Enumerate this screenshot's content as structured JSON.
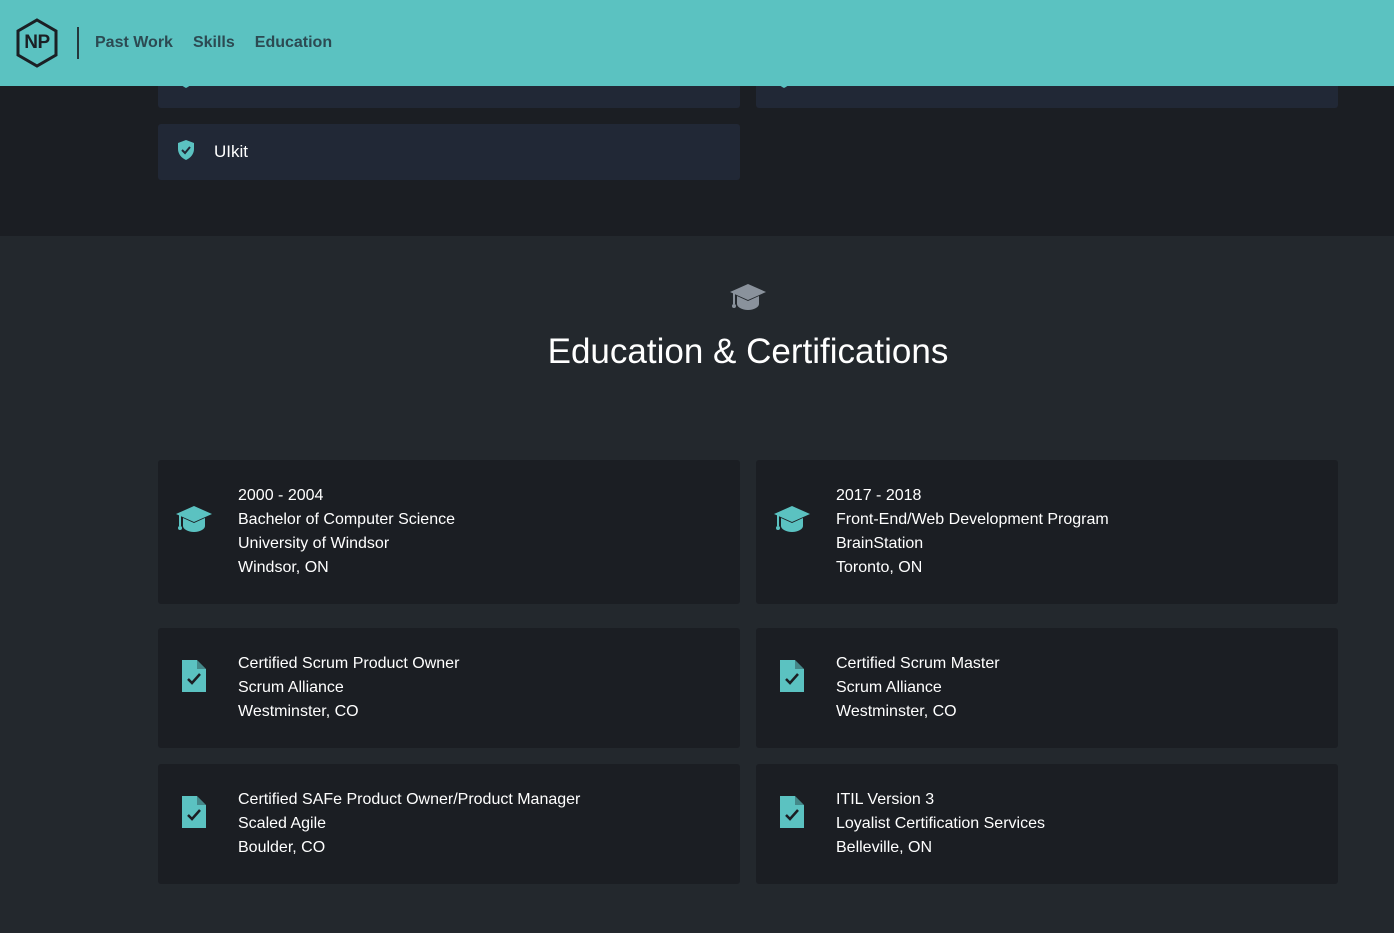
{
  "nav": {
    "logo_text": "NP",
    "links": [
      "Past Work",
      "Skills",
      "Education"
    ]
  },
  "skills": {
    "visible_card_label": "UIkit"
  },
  "education": {
    "title": "Education & Certifications",
    "degrees": [
      {
        "years": "2000 - 2004",
        "program": "Bachelor of Computer Science",
        "school": "University of Windsor",
        "location": "Windsor, ON"
      },
      {
        "years": "2017 - 2018",
        "program": "Front-End/Web Development Program",
        "school": "BrainStation",
        "location": "Toronto, ON"
      }
    ],
    "certifications": [
      {
        "name": "Certified Scrum Product Owner",
        "issuer": "Scrum Alliance",
        "location": "Westminster, CO"
      },
      {
        "name": "Certified Scrum Master",
        "issuer": "Scrum Alliance",
        "location": "Westminster, CO"
      },
      {
        "name": "Certified SAFe Product Owner/Product Manager",
        "issuer": "Scaled Agile",
        "location": "Boulder, CO"
      },
      {
        "name": "ITIL Version 3",
        "issuer": "Loyalist Certification Services",
        "location": "Belleville, ON"
      }
    ]
  },
  "colors": {
    "accent": "#5bc2c1",
    "nav_text": "#2c4a52",
    "page_bg": "#23282d",
    "card_bg": "#1b1e23",
    "skill_card_bg": "#212836"
  }
}
